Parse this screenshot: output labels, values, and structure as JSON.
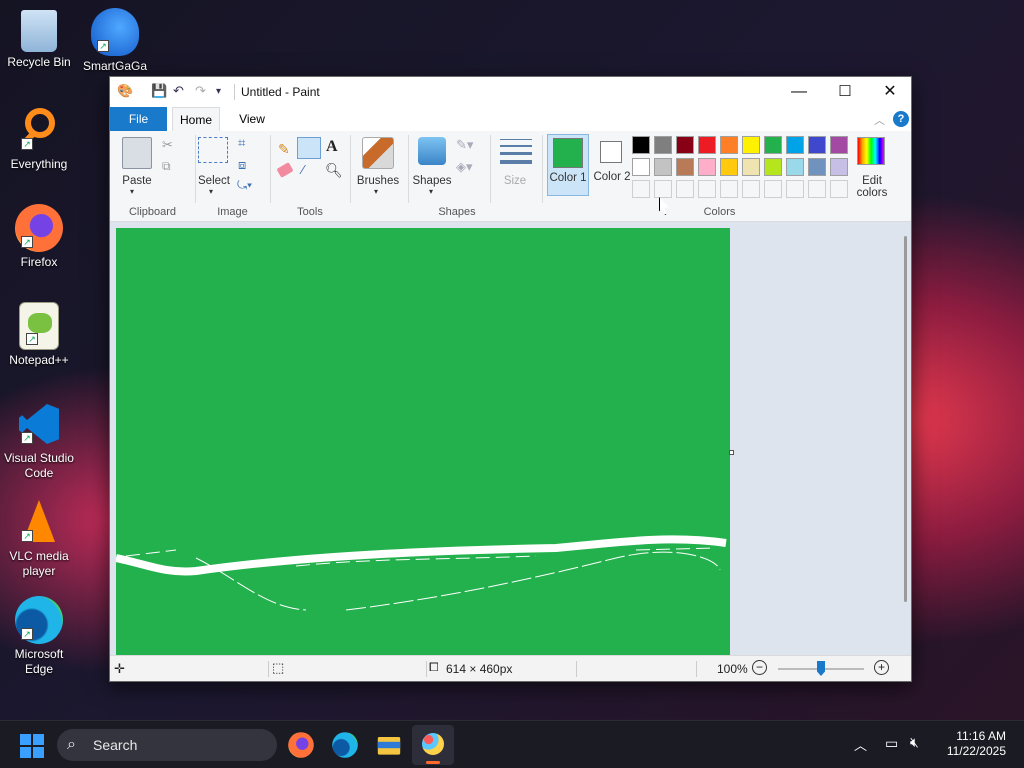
{
  "desktop": {
    "icons": [
      "Recycle Bin",
      "SmartGaGa",
      "Everything",
      "Firefox",
      "Notepad++",
      "Visual Studio Code",
      "VLC media player",
      "Microsoft Edge"
    ]
  },
  "window": {
    "title": "Untitled - Paint",
    "minimize": "—",
    "maximize": "☐",
    "close": "✕"
  },
  "tabs": {
    "file": "File",
    "home": "Home",
    "view": "View",
    "help": "?"
  },
  "ribbon": {
    "paste": "Paste",
    "select": "Select",
    "brushes": "Brushes",
    "shapes": "Shapes",
    "size": "Size",
    "color1": "Color 1",
    "color2": "Color 2",
    "edit_colors": "Edit colors",
    "groups": {
      "clipboard": "Clipboard",
      "image": "Image",
      "tools": "Tools",
      "shapes": "Shapes",
      "colors": "Colors"
    },
    "palette_row1": [
      "#000000",
      "#7f7f7f",
      "#880015",
      "#ed1c24",
      "#ff7f27",
      "#fff200",
      "#22b14c",
      "#00a2e8",
      "#3f48cc",
      "#a349a4"
    ],
    "palette_row2": [
      "#ffffff",
      "#c3c3c3",
      "#b97a57",
      "#ffaec9",
      "#ffc90e",
      "#efe4b0",
      "#b5e61d",
      "#99d9ea",
      "#7092be",
      "#c8bfe7"
    ],
    "color1_value": "#22b14c",
    "color2_value": "#ffffff"
  },
  "status": {
    "size": "614 × 460px",
    "zoom": "100%",
    "zoom_level": 0.5
  },
  "taskbar": {
    "search": "Search",
    "time": "11:16 AM",
    "date": "11/22/2025"
  }
}
